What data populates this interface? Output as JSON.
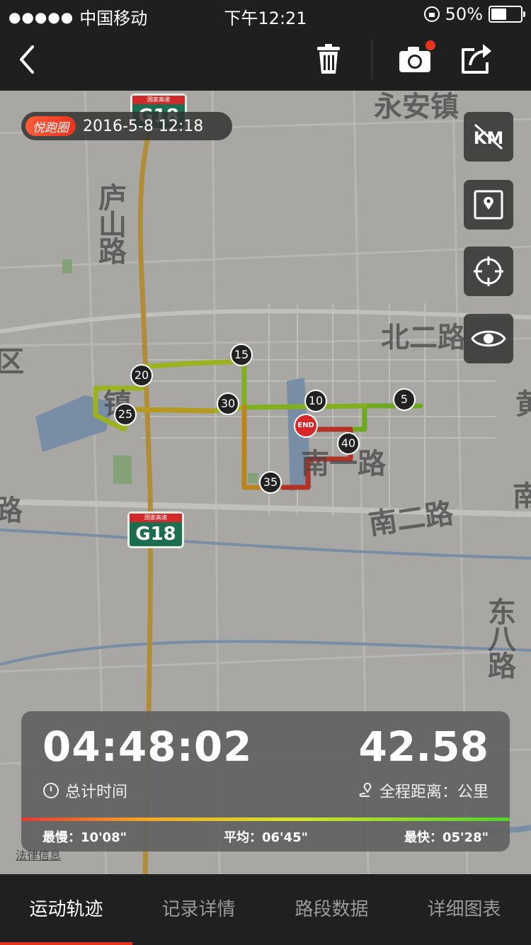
{
  "status_bar": {
    "signal_dots": "●●●●●",
    "carrier": "中国移动",
    "time": "下午12:21",
    "battery": "50%"
  },
  "nav": {
    "icons": [
      "back-icon",
      "trash-icon",
      "camera-icon",
      "share-icon"
    ]
  },
  "record": {
    "brand_tag": "悦跑圈",
    "datetime": "2016-5-8 12:18"
  },
  "map_controls": {
    "km_toggle": "KM",
    "icons": [
      "km-off-icon",
      "map-pin-icon",
      "locate-icon",
      "eye-icon"
    ]
  },
  "map": {
    "highway": "G18",
    "highway_small": "国家高速",
    "labels": [
      "永安镇",
      "庐山路",
      "北二路",
      "南一路",
      "南二路",
      "东八路",
      "区",
      "黄",
      "南",
      "路",
      "镇"
    ],
    "km_markers": [
      "5",
      "10",
      "15",
      "20",
      "25",
      "30",
      "35",
      "40"
    ],
    "end_label": "END",
    "legal": "法律信息"
  },
  "stats": {
    "total_time": "04:48:02",
    "total_time_label": "总计时间",
    "distance": "42.58",
    "distance_label": "全程距离：公里",
    "slowest": "最慢：10'08\"",
    "average": "平均：06'45\"",
    "fastest": "最快：05'28\""
  },
  "tabs": [
    "运动轨迹",
    "记录详情",
    "路段数据",
    "详细图表"
  ],
  "colors": {
    "accent": "#e8341f",
    "slow": "#e53935",
    "mid": "#f5a623",
    "fast": "#51d12a"
  }
}
